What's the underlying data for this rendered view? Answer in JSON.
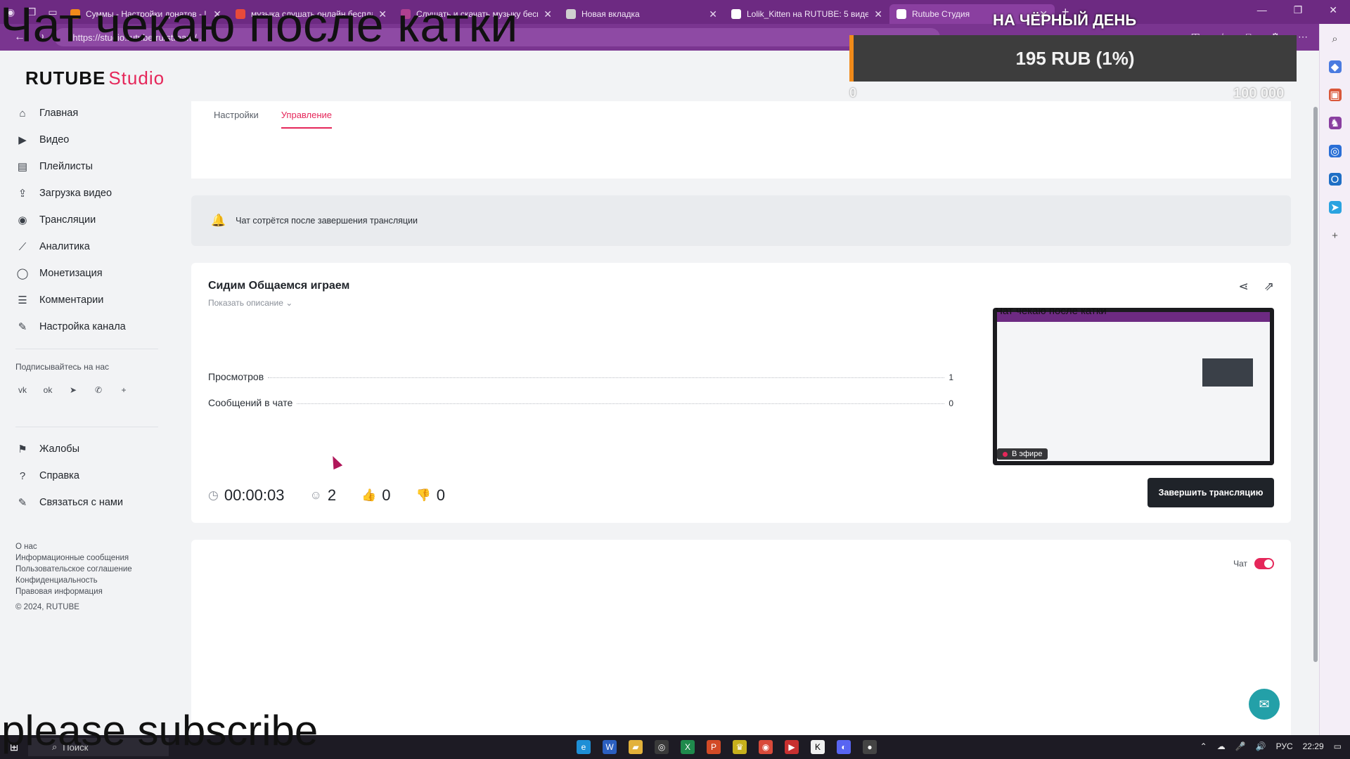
{
  "browser": {
    "tabs": [
      {
        "label": "Суммы - Настройки донатов - !",
        "favicon_color": "#f08a1a"
      },
      {
        "label": "музыка слушать онлайн беспла",
        "favicon_color": "#e84a3a"
      },
      {
        "label": "Слушать и скачать музыку бесп",
        "favicon_color": "#b04090"
      },
      {
        "label": "Новая вкладка",
        "favicon_color": "#cfcfcf"
      },
      {
        "label": "Lolik_Kitten на RUTUBE: 5 видео",
        "favicon_color": "#ffffff"
      },
      {
        "label": "Rutube Студия",
        "favicon_color": "#ffffff"
      }
    ],
    "url": "https://studio.rutube.ru/stream/..."
  },
  "overlays": {
    "top_caption": "Чат чекаю после катки",
    "bottom_caption": "please subscribe",
    "donation_title": "НА ЧЁРНЫЙ ДЕНЬ",
    "donation_amount": "195 RUB (1%)",
    "donation_min": "0",
    "donation_max": "100 000",
    "donation_progress": 0.01
  },
  "brand": {
    "logo_main": "RUTUBE",
    "logo_sub": "Studio",
    "accent": "#e5275a"
  },
  "sidebar": {
    "items": [
      {
        "label": "Главная",
        "icon": "home-icon"
      },
      {
        "label": "Видео",
        "icon": "video-icon"
      },
      {
        "label": "Плейлисты",
        "icon": "playlist-icon"
      },
      {
        "label": "Загрузка видео",
        "icon": "upload-icon"
      },
      {
        "label": "Трансляции",
        "icon": "broadcast-icon"
      },
      {
        "label": "Аналитика",
        "icon": "analytics-icon"
      },
      {
        "label": "Монетизация",
        "icon": "coin-icon"
      },
      {
        "label": "Комментарии",
        "icon": "comments-icon"
      },
      {
        "label": "Настройка канала",
        "icon": "wand-icon"
      }
    ],
    "subscribe_label": "Подписывайтесь на нас",
    "bottom_items": [
      {
        "label": "Жалобы",
        "icon": "flag-icon"
      },
      {
        "label": "Справка",
        "icon": "help-icon"
      },
      {
        "label": "Связаться с нами",
        "icon": "edit-icon"
      }
    ],
    "footer_links": [
      "О нас",
      "Информационные сообщения",
      "Пользовательское соглашение",
      "Конфиденциальность",
      "Правовая информация"
    ],
    "copyright": "© 2024, RUTUBE"
  },
  "tabs": {
    "settings": "Настройки",
    "management": "Управление"
  },
  "notice": "Чат сотрётся после завершения трансляции",
  "stream": {
    "title": "Сидим Общаемся играем",
    "show_description": "Показать описание",
    "stats": [
      {
        "label": "Просмотров",
        "value": "1"
      },
      {
        "label": "Сообщений в чате",
        "value": "0"
      }
    ],
    "duration": "00:00:03",
    "viewers": "2",
    "likes": "0",
    "dislikes": "0",
    "live_label": "В эфире",
    "end_button": "Завершить трансляцию"
  },
  "chat": {
    "label": "Чат",
    "enabled": true
  },
  "taskbar": {
    "search_placeholder": "Поиск",
    "language": "РУС",
    "time": "22:29"
  }
}
